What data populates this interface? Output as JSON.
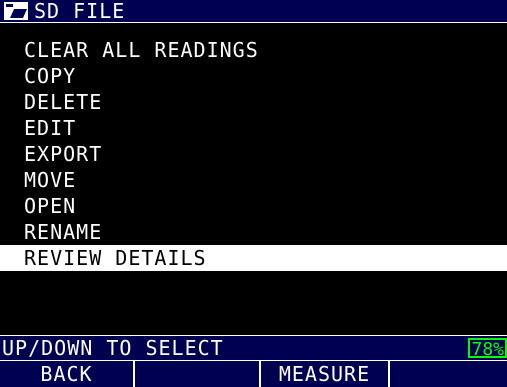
{
  "title": {
    "icon": "folder-icon",
    "text": "SD FILE"
  },
  "menu": {
    "items": [
      {
        "label": "CLEAR ALL READINGS",
        "selected": false
      },
      {
        "label": "COPY",
        "selected": false
      },
      {
        "label": "DELETE",
        "selected": false
      },
      {
        "label": "EDIT",
        "selected": false
      },
      {
        "label": "EXPORT",
        "selected": false
      },
      {
        "label": "MOVE",
        "selected": false
      },
      {
        "label": "OPEN",
        "selected": false
      },
      {
        "label": "RENAME",
        "selected": false
      },
      {
        "label": "REVIEW DETAILS",
        "selected": true
      }
    ]
  },
  "status": {
    "text": "UP/DOWN TO SELECT",
    "battery": "78%",
    "battery_color": "#00ff00"
  },
  "softkeys": [
    {
      "label": "BACK"
    },
    {
      "label": ""
    },
    {
      "label": "MEASURE"
    },
    {
      "label": ""
    }
  ],
  "colors": {
    "background": "#000000",
    "bar": "#000050",
    "text": "#ffffff",
    "highlight_bg": "#ffffff",
    "highlight_text": "#000000"
  }
}
